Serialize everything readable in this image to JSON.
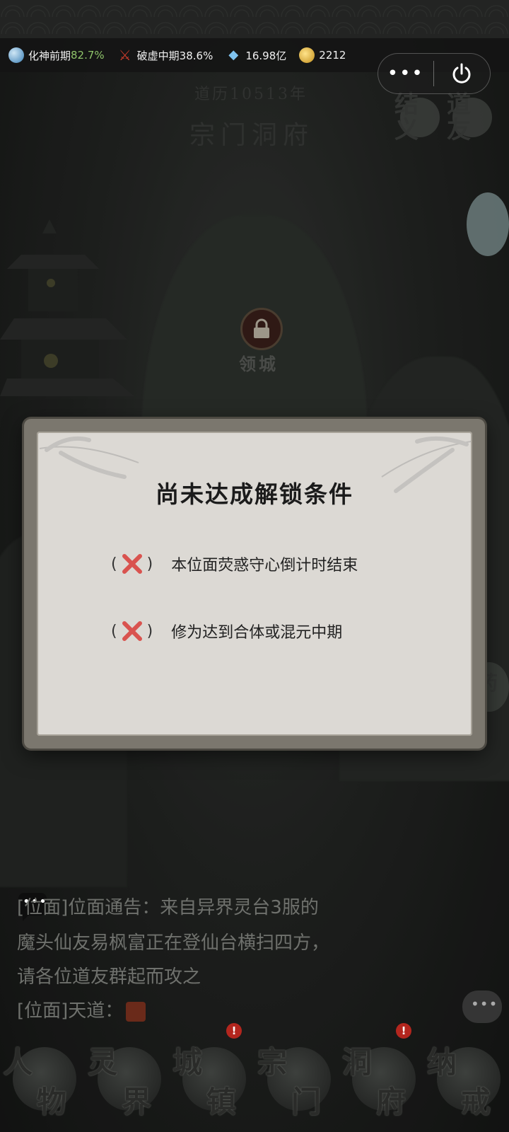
{
  "status_bar": {
    "cultivation_label": "化神前期",
    "cultivation_pct": "82.7%",
    "rank_label": "破虚中期38.6%",
    "spirit_stones": "16.98亿",
    "gold": "2212"
  },
  "capsule": {
    "more_label": "•••"
  },
  "header": {
    "calendar": "道历10513年",
    "title": "宗门洞府"
  },
  "side_tags": {
    "jieyi": "结义",
    "daoyou": "道友",
    "yao": "药"
  },
  "map": {
    "locked_area_label": "领城"
  },
  "modal": {
    "title": "尚未达成解锁条件",
    "conditions": [
      {
        "paren_open": "(",
        "paren_close": ")",
        "text": "本位面荧惑守心倒计时结束"
      },
      {
        "paren_open": "(",
        "paren_close": ")",
        "text": "修为达到合体或混元中期"
      }
    ]
  },
  "chat": {
    "line1": "[位面]位面通告：来自异界灵台3服的",
    "line2": "魔头仙友易枫富正在登仙台横扫四方，",
    "line3": "请各位道友群起而攻之",
    "line4": "[位面]天道："
  },
  "nav": [
    {
      "c1": "人",
      "c2": "物",
      "badge": ""
    },
    {
      "c1": "灵",
      "c2": "界",
      "badge": ""
    },
    {
      "c1": "城",
      "c2": "镇",
      "badge": "!"
    },
    {
      "c1": "宗",
      "c2": "门",
      "badge": ""
    },
    {
      "c1": "洞",
      "c2": "府",
      "badge": "!"
    },
    {
      "c1": "纳",
      "c2": "戒",
      "badge": ""
    }
  ],
  "colors": {
    "accent_green": "#8fc46a",
    "cross_red": "#d9534f",
    "modal_bg": "#dcd9d4"
  }
}
